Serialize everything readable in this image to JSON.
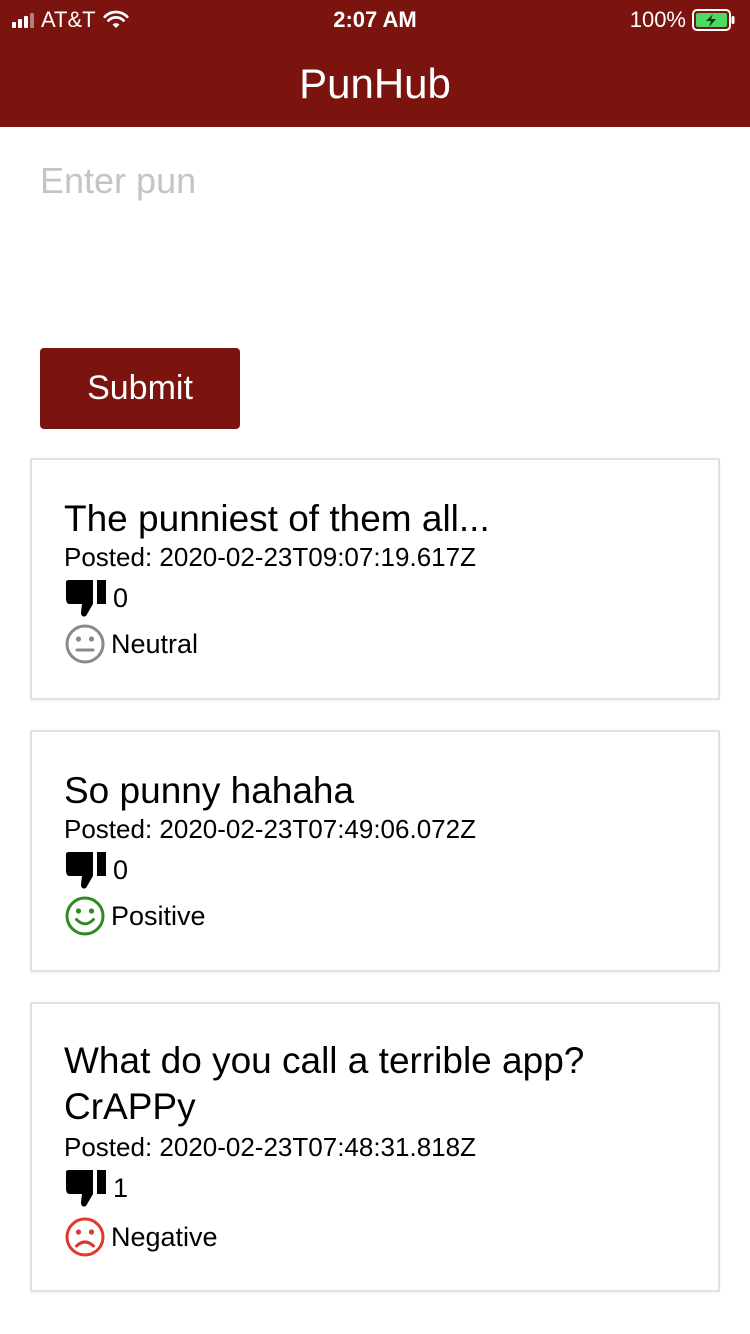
{
  "status_bar": {
    "carrier": "AT&T",
    "time": "2:07 AM",
    "battery": "100%"
  },
  "header": {
    "title": "PunHub"
  },
  "form": {
    "placeholder": "Enter pun",
    "submit_label": "Submit"
  },
  "colors": {
    "brand": "#7b130e",
    "neutral": "#8a8a8a",
    "positive": "#2e8b1f",
    "negative": "#e0382c"
  },
  "puns": [
    {
      "text": "The punniest of them all...",
      "posted": "Posted: 2020-02-23T09:07:19.617Z",
      "votes": "0",
      "sentiment": "Neutral",
      "sentiment_icon": "neutral-face-icon"
    },
    {
      "text": "So punny hahaha",
      "posted": "Posted: 2020-02-23T07:49:06.072Z",
      "votes": "0",
      "sentiment": "Positive",
      "sentiment_icon": "smile-face-icon"
    },
    {
      "text": "What do you call a terrible app? CrAPPy",
      "posted": "Posted: 2020-02-23T07:48:31.818Z",
      "votes": "1",
      "sentiment": "Negative",
      "sentiment_icon": "frown-face-icon"
    }
  ]
}
